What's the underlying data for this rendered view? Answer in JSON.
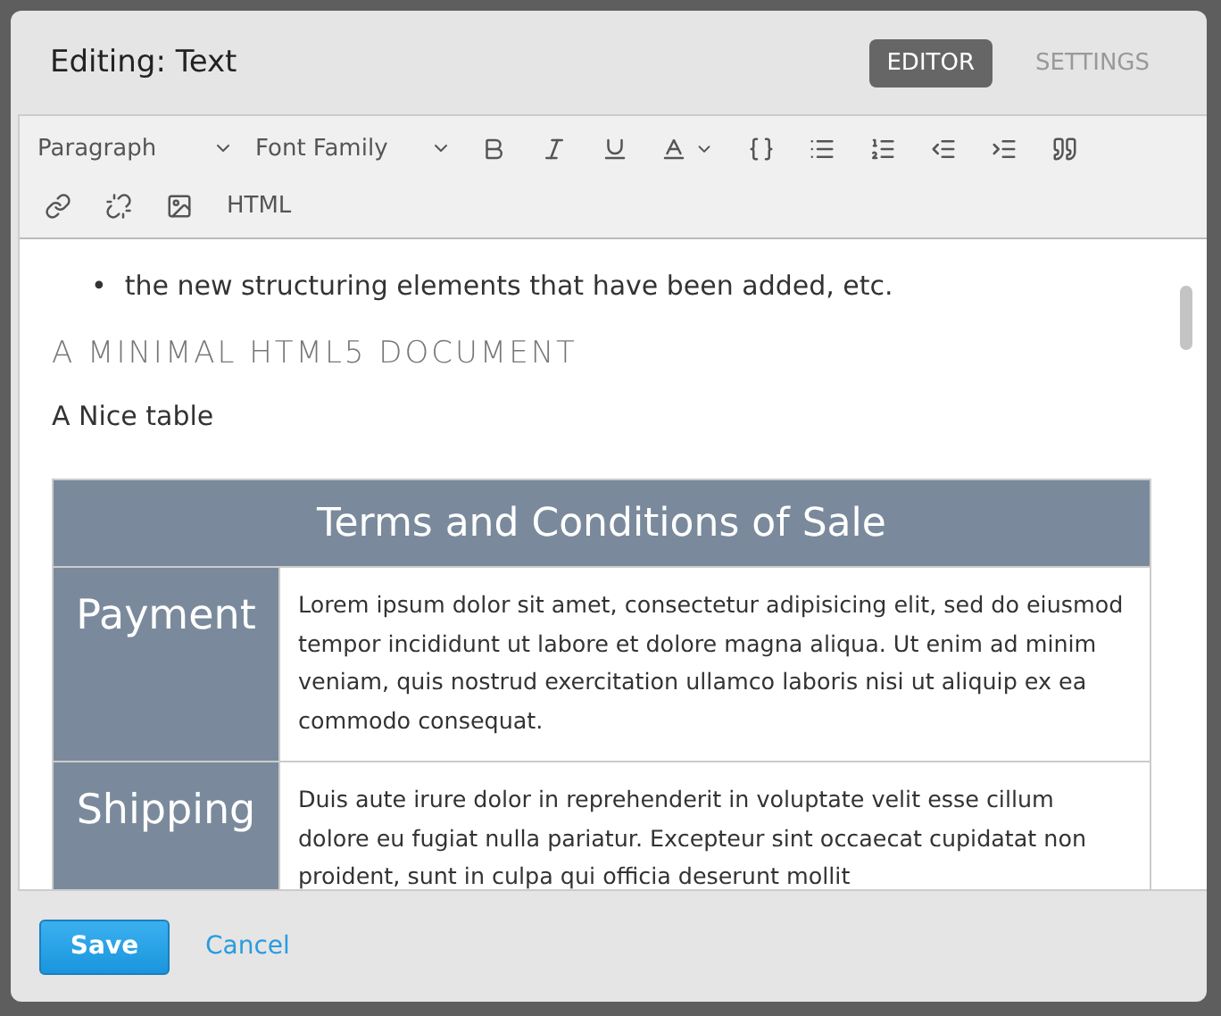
{
  "dialog": {
    "title": "Editing: Text"
  },
  "tabs": [
    {
      "label": "EDITOR",
      "selected": true
    },
    {
      "label": "SETTINGS",
      "selected": false
    }
  ],
  "toolbar": {
    "rows": [
      [
        {
          "kind": "dropdown",
          "label": "Paragraph"
        },
        {
          "kind": "dropdown",
          "label": "Font Family"
        },
        {
          "kind": "icon"
        },
        {
          "kind": "icon"
        },
        {
          "kind": "icon"
        },
        {
          "kind": "color"
        },
        {
          "kind": "icon"
        },
        {
          "kind": "icon"
        },
        {
          "kind": "icon"
        },
        {
          "kind": "icon"
        },
        {
          "kind": "icon"
        },
        {
          "kind": "icon"
        }
      ],
      [
        {
          "kind": "icon"
        },
        {
          "kind": "icon"
        },
        {
          "kind": "icon"
        },
        {
          "kind": "text",
          "label": "HTML"
        }
      ]
    ]
  },
  "content": {
    "bullets": [
      {
        "marker": "•",
        "text": "the new structuring elements that have been added, etc."
      }
    ],
    "heading": "A MINIMAL HTML5 DOCUMENT",
    "paragraph": "A Nice table",
    "table": {
      "caption": "Terms and Conditions of Sale",
      "rows": [
        {
          "header": "Payment",
          "text": "Lorem ipsum dolor sit amet, consectetur adipisicing elit, sed do eiusmod tempor incididunt ut labore et dolore magna aliqua. Ut enim ad minim veniam, quis nostrud exercitation ullamco laboris nisi ut aliquip ex ea commodo consequat."
        },
        {
          "header": "Shipping",
          "text": "Duis aute irure dolor in reprehenderit in voluptate velit esse cillum dolore eu fugiat nulla pariatur. Excepteur sint occaecat cupidatat non proident, sunt in culpa qui officia deserunt mollit"
        }
      ]
    }
  },
  "footer": {
    "save": "Save",
    "cancel": "Cancel"
  }
}
